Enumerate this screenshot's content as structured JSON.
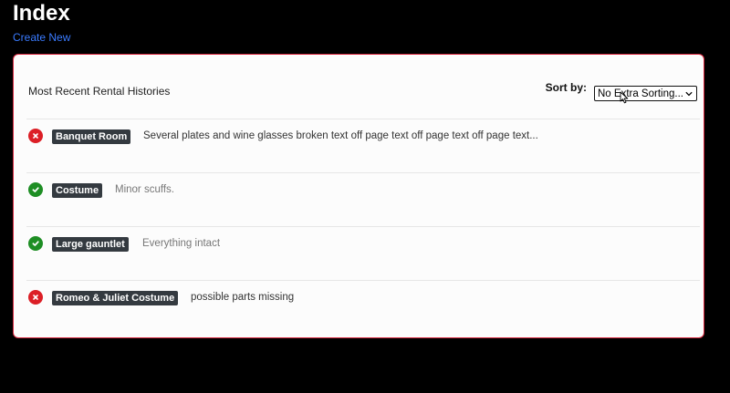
{
  "page": {
    "title": "Index",
    "create_link": "Create New"
  },
  "card": {
    "title": "Most Recent Rental Histories",
    "sort_label": "Sort by:",
    "sort_selected": "No Extra Sorting..."
  },
  "rows": [
    {
      "status": "failed",
      "item": "Banquet Room",
      "note": "Several plates and wine glasses broken text off page text off page text off page text..."
    },
    {
      "status": "passed",
      "item": "Costume",
      "note": "Minor scuffs."
    },
    {
      "status": "passed",
      "item": "Large gauntlet",
      "note": "Everything intact"
    },
    {
      "status": "failed",
      "item": "Romeo & Juliet Costume",
      "note": "possible parts missing"
    }
  ],
  "colors": {
    "failed": "#dc1f26",
    "passed": "#1e8e24",
    "card_border": "#d7263d",
    "link": "#3a7bff"
  }
}
